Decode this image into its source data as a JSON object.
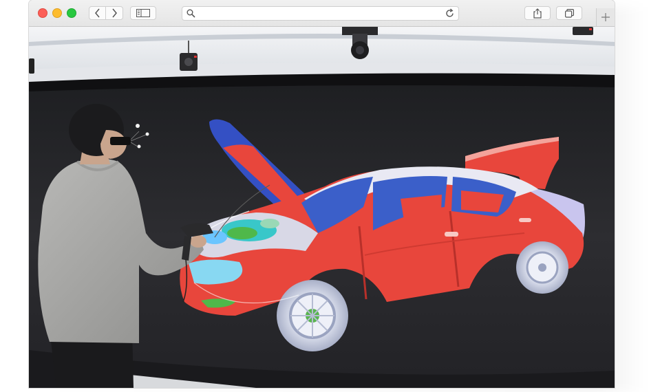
{
  "window": {
    "controls": [
      "close",
      "minimize",
      "zoom"
    ]
  },
  "toolbar": {
    "back_icon": "chevron-left-icon",
    "forward_icon": "chevron-right-icon",
    "sidebar_icon": "sidebar-icon",
    "share_icon": "share-icon",
    "tabs_icon": "tabs-overview-icon",
    "new_tab_icon": "plus-icon"
  },
  "address_bar": {
    "value": "",
    "placeholder": "",
    "search_icon": "search-icon",
    "reload_icon": "reload-icon"
  },
  "content": {
    "description_icon": "photo-vr-car-review",
    "colors": {
      "car_body": "#e8463c",
      "car_glass": "#3b5fc9",
      "screen_bg": "#262629",
      "ceiling": "#e9ecef"
    }
  }
}
